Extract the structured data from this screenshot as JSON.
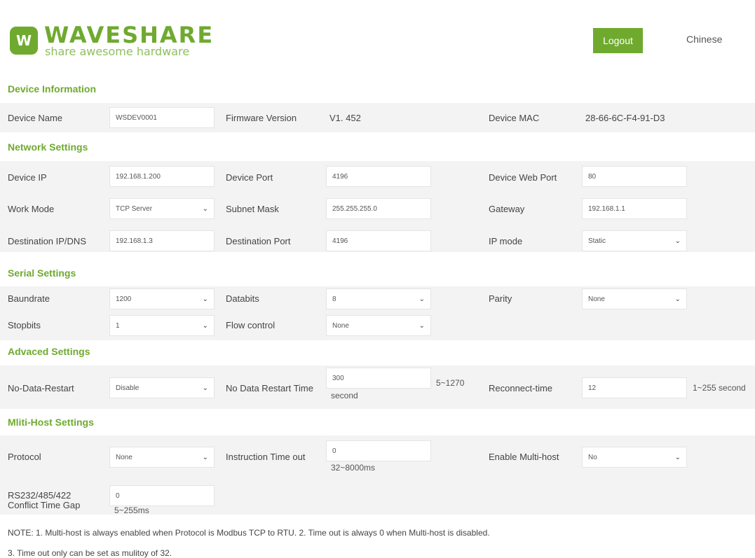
{
  "header": {
    "logo_mark": "W",
    "logo_name": "WAVESHARE",
    "logo_tagline": "share awesome hardware",
    "logout_label": "Logout",
    "language_label": "Chinese"
  },
  "device_info": {
    "title": "Device Information",
    "device_name_label": "Device Name",
    "device_name_value": "WSDEV0001",
    "firmware_label": "Firmware Version",
    "firmware_value": "V1. 452",
    "mac_label": "Device MAC",
    "mac_value": "28-66-6C-F4-91-D3"
  },
  "network": {
    "title": "Network Settings",
    "device_ip_label": "Device IP",
    "device_ip_value": "192.168.1.200",
    "device_port_label": "Device Port",
    "device_port_value": "4196",
    "web_port_label": "Device Web Port",
    "web_port_value": "80",
    "work_mode_label": "Work Mode",
    "work_mode_value": "TCP Server",
    "subnet_label": "Subnet Mask",
    "subnet_value": "255.255.255.0",
    "gateway_label": "Gateway",
    "gateway_value": "192.168.1.1",
    "dest_ip_label": "Destination IP/DNS",
    "dest_ip_value": "192.168.1.3",
    "dest_port_label": "Destination Port",
    "dest_port_value": "4196",
    "ip_mode_label": "IP mode",
    "ip_mode_value": "Static"
  },
  "serial": {
    "title": "Serial Settings",
    "baud_label": "Baundrate",
    "baud_value": "1200",
    "databits_label": "Databits",
    "databits_value": "8",
    "parity_label": "Parity",
    "parity_value": "None",
    "stopbits_label": "Stopbits",
    "stopbits_value": "1",
    "flow_label": "Flow control",
    "flow_value": "None"
  },
  "advanced": {
    "title": "Advaced Settings",
    "no_data_restart_label": "No-Data-Restart",
    "no_data_restart_value": "Disable",
    "restart_time_label": "No Data Restart Time",
    "restart_time_value": "300",
    "restart_time_range": "5~1270",
    "restart_time_unit": "second",
    "reconnect_label": "Reconnect-time",
    "reconnect_value": "12",
    "reconnect_range": "1~255 second"
  },
  "multihost": {
    "title": "Mliti-Host Settings",
    "protocol_label": "Protocol",
    "protocol_value": "None",
    "timeout_label": "Instruction Time out",
    "timeout_value": "0",
    "timeout_range": "32~8000ms",
    "enable_label": "Enable Multi-host",
    "enable_value": "No",
    "conflict_label_1": "RS232/485/422",
    "conflict_label_2": "Conflict Time Gap",
    "conflict_value": "0",
    "conflict_range": "5~255ms"
  },
  "notes": {
    "note1": "NOTE: 1. Multi-host is always enabled when Protocol is Modbus TCP to RTU. 2. Time out is always 0 when Multi-host is disabled.",
    "note2": "3. Time out only can be set as mulitoy of 32."
  },
  "icons": {
    "chevron": "⌄"
  },
  "colors": {
    "accent": "#6faa2f",
    "row_bg": "#f3f3f3"
  }
}
